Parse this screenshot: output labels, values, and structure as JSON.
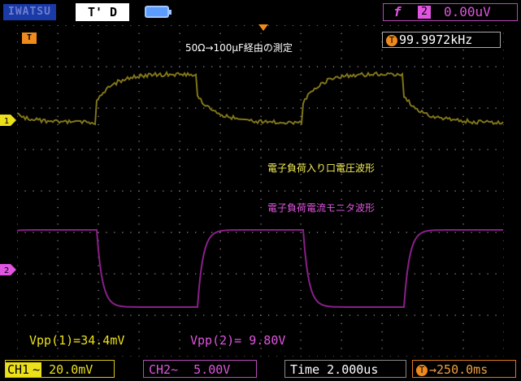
{
  "header": {
    "brand": "IWATSU",
    "trigger_status": "T' D",
    "battery_icon": "battery-icon",
    "measure": {
      "symbol": "f",
      "channel": "2",
      "value": "0.00uV"
    }
  },
  "screen": {
    "frequency_readout": "99.9972kHz",
    "title_annotation": "50Ω→100μF経由の測定",
    "label_ch1_wave": "電子負荷入り口電圧波形",
    "label_ch2_wave": "電子負荷電流モニタ波形",
    "vpp1": "Vpp(1)=34.4mV",
    "vpp2": "Vpp(2)= 9.80V",
    "ch1_marker": "1",
    "ch2_marker": "2",
    "trigger_marker": "T"
  },
  "footer": {
    "ch1_label": "CH1",
    "ch1_coupling": "~",
    "ch1_scale": "20.0mV",
    "ch2_label": "CH2~",
    "ch2_scale": "5.00V",
    "time_label": "Time",
    "time_scale": "2.000us",
    "delay_badge": "T",
    "delay_value": "→250.0ms"
  },
  "colors": {
    "ch1": "#7f7418",
    "ch2": "#8a1f8a",
    "ch1_text": "#ece01a",
    "ch2_text": "#e055e0",
    "grid": "#9a9a9a",
    "trigger": "#f08a1c"
  }
}
